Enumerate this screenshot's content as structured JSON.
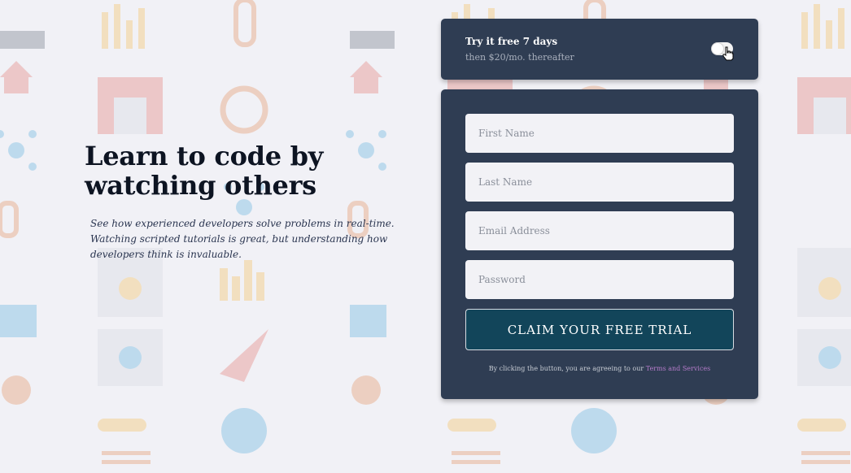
{
  "hero": {
    "heading_line1": "Learn to code by",
    "heading_line2": "watching others",
    "description": "See how experienced developers solve problems in real-time. Watching scripted tutorials is great, but understanding how developers think is invaluable."
  },
  "trial_bar": {
    "title": "Try it free 7 days",
    "subtitle": "then $20/mo. thereafter",
    "toggle_icon": "toggle-switch-icon",
    "cursor_icon": "hand-pointer-icon"
  },
  "form": {
    "first_name_placeholder": "First Name",
    "last_name_placeholder": "Last Name",
    "email_placeholder": "Email Address",
    "password_placeholder": "Password",
    "submit_label": "CLAIM YOUR FREE TRIAL",
    "terms_prefix": "By clicking the button, you are agreeing to our ",
    "terms_link": "Terms and Services"
  },
  "colors": {
    "page_background": "#f1f1f6",
    "card_background": "#2f3d53",
    "button_background": "#12455a",
    "link_color": "#b57bc9",
    "heading_color": "#0d1422"
  }
}
